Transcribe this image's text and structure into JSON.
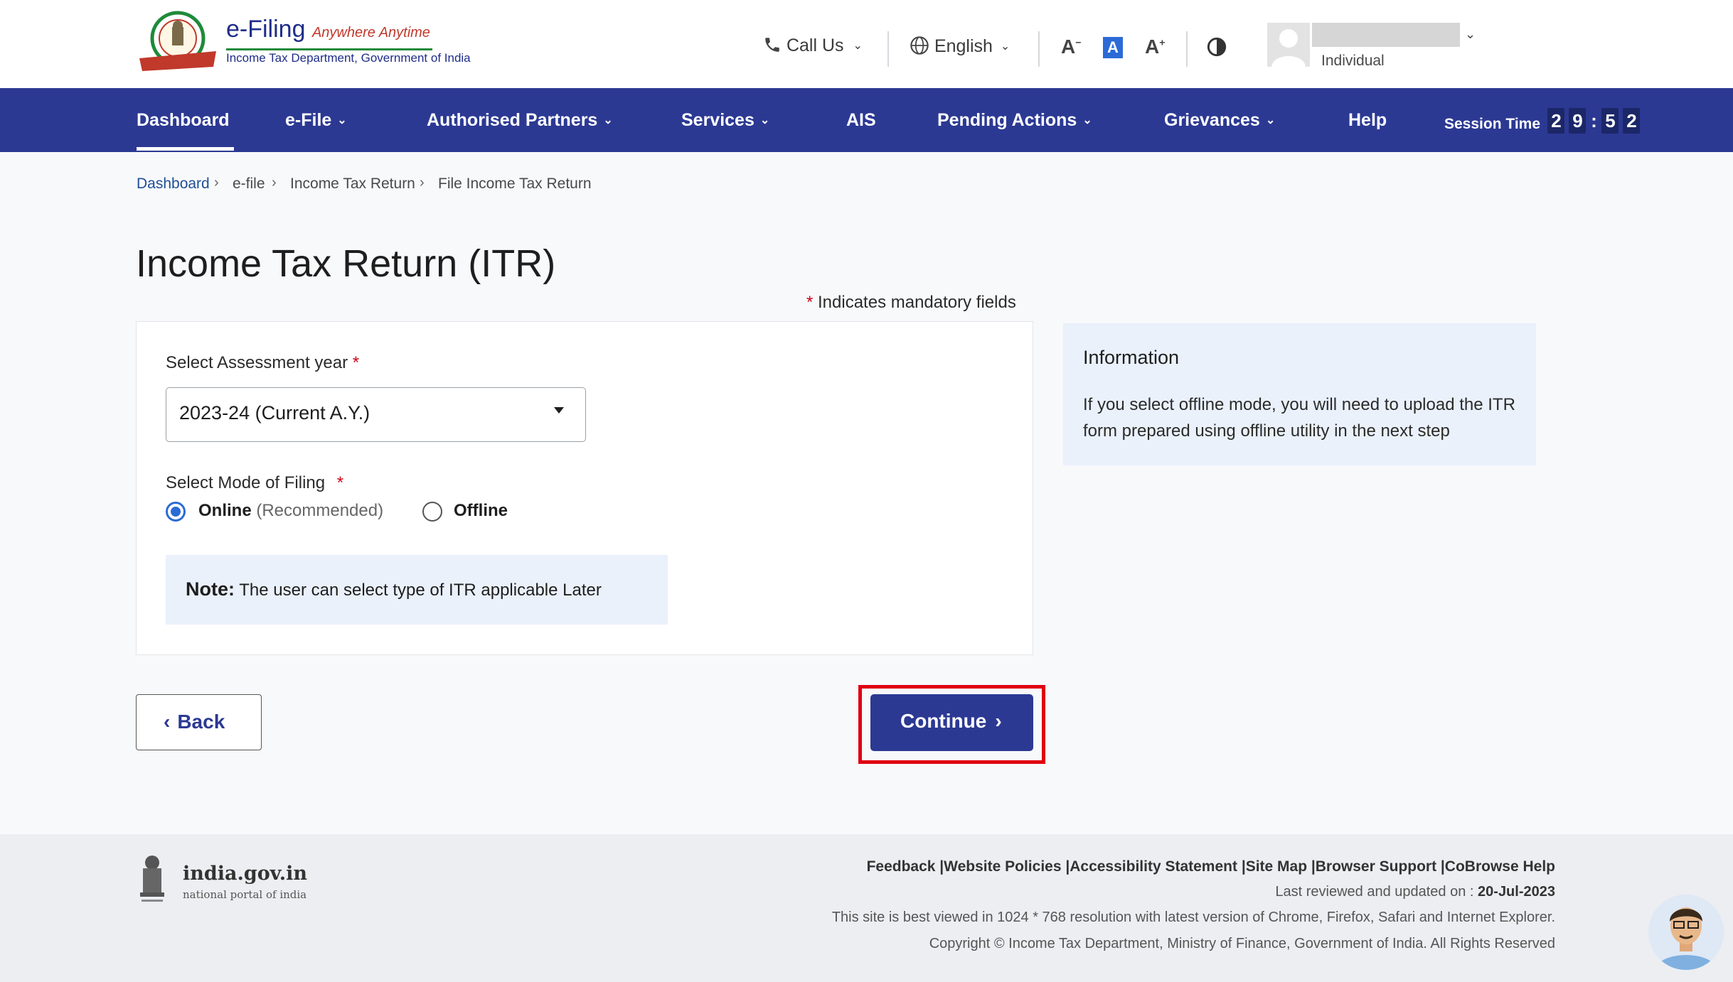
{
  "header": {
    "logo_title": "e-Filing",
    "logo_tagline": "Anywhere Anytime",
    "logo_subtitle": "Income Tax Department, Government of India",
    "call_us": "Call Us",
    "language": "English",
    "user_type": "Individual"
  },
  "nav": {
    "items": [
      {
        "label": "Dashboard"
      },
      {
        "label": "e-File"
      },
      {
        "label": "Authorised Partners"
      },
      {
        "label": "Services"
      },
      {
        "label": "AIS"
      },
      {
        "label": "Pending Actions"
      },
      {
        "label": "Grievances"
      },
      {
        "label": "Help"
      }
    ],
    "session_label": "Session Time",
    "session_digits": [
      "2",
      "9",
      "5",
      "2"
    ]
  },
  "breadcrumb": [
    "Dashboard",
    "e-file",
    "Income Tax Return",
    "File Income Tax Return"
  ],
  "page_title": "Income Tax Return (ITR)",
  "mandatory_note": "Indicates mandatory fields",
  "form": {
    "ay_label": "Select Assessment year",
    "ay_value": "2023-24 (Current A.Y.)",
    "mode_label": "Select Mode of Filing",
    "option_online": "Online",
    "option_online_hint": "(Recommended)",
    "option_offline": "Offline",
    "note_title": "Note:",
    "note_text": "The user can select type of ITR applicable Later"
  },
  "info": {
    "title": "Information",
    "text": "If you select offline mode, you will need to upload the ITR form prepared using offline utility in the next step"
  },
  "buttons": {
    "back": "Back",
    "continue": "Continue"
  },
  "footer": {
    "portal_name": "india.gov.in",
    "portal_tagline": "national portal of india",
    "links": "Feedback |Website Policies |Accessibility Statement |Site Map |Browser Support |CoBrowse Help",
    "last_reviewed_label": "Last reviewed and updated on : ",
    "last_reviewed_date": "20-Jul-2023",
    "best_viewed": "This site is best viewed in 1024 * 768 resolution with latest version of Chrome, Firefox, Safari and Internet Explorer.",
    "copyright": "Copyright © Income Tax Department, Ministry of Finance, Government of India. All Rights Reserved"
  },
  "colors": {
    "primary": "#2c3993",
    "highlight": "#e0000f",
    "required": "#d0021b",
    "info_bg": "#eaf1fb"
  }
}
